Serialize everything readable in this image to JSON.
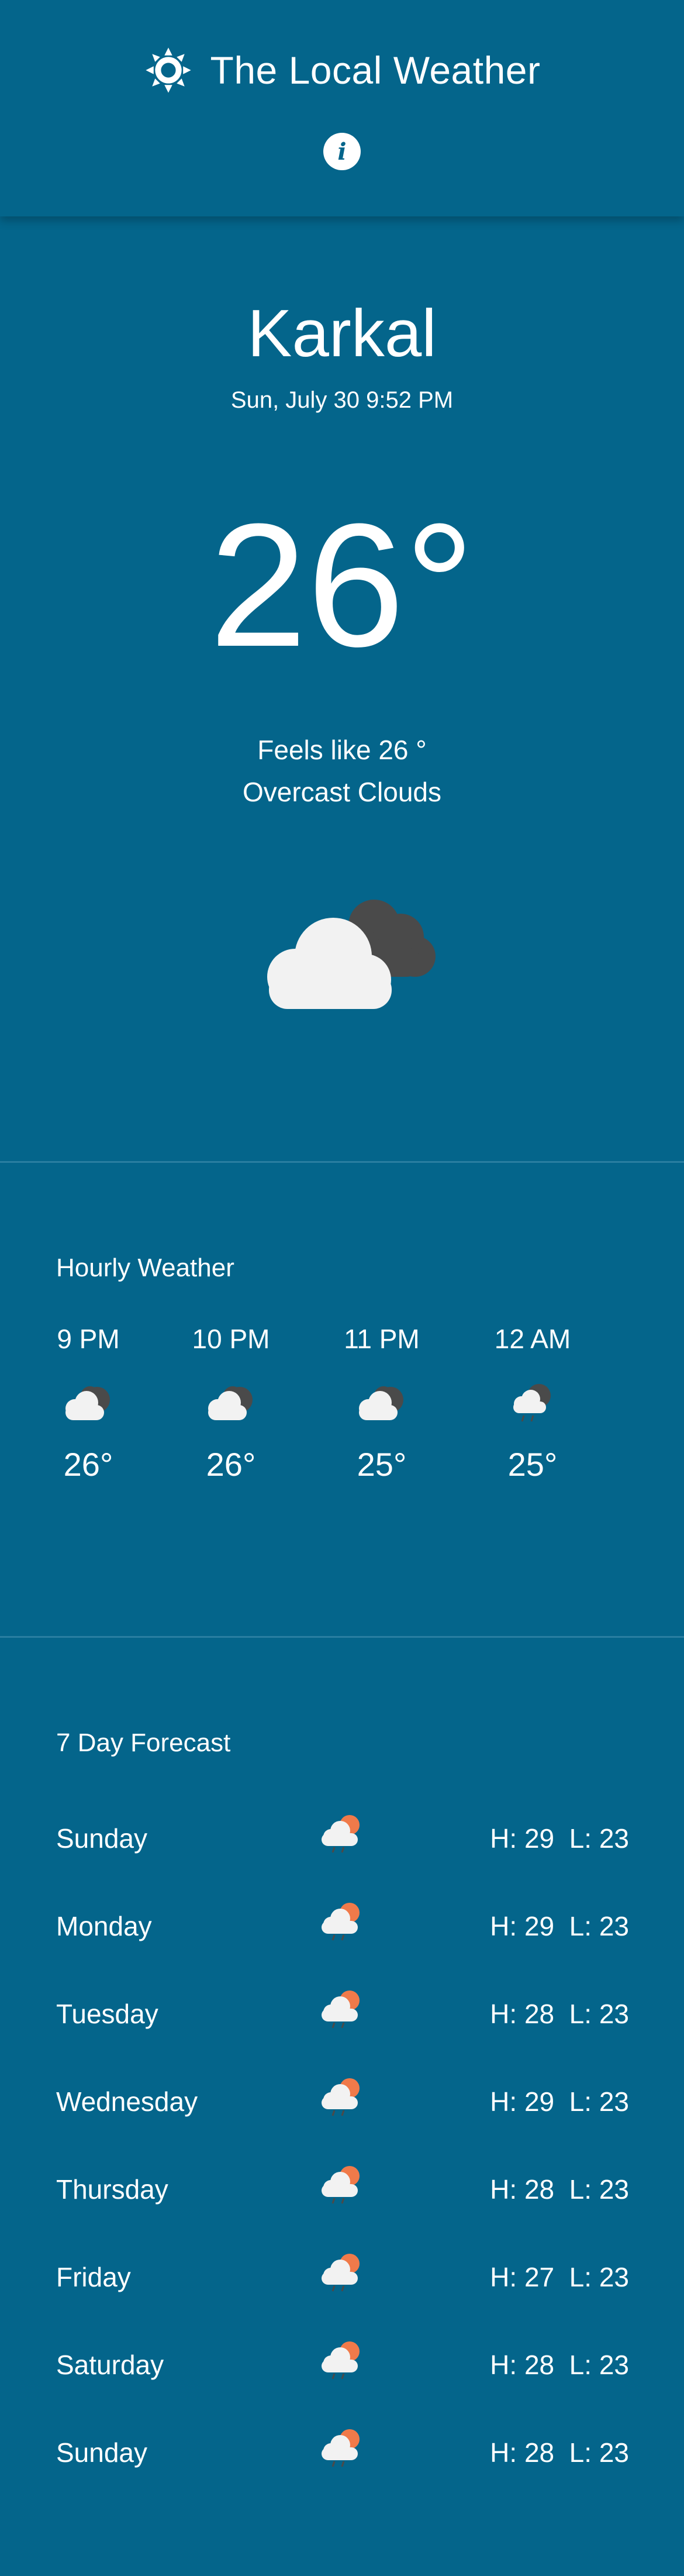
{
  "header": {
    "title": "The Local Weather",
    "logo_icon": "sun-icon",
    "info_icon": "info-icon",
    "info_glyph": "i"
  },
  "current": {
    "city": "Karkal",
    "datetime": "Sun, July 30 9:52 PM",
    "temperature": "26°",
    "feels_like": "Feels like 26 °",
    "description": "Overcast Clouds",
    "icon": "overcast-clouds-icon"
  },
  "hourly": {
    "title": "Hourly Weather",
    "items": [
      {
        "time": "9 PM",
        "temp": "26°",
        "icon": "cloud-moon-icon"
      },
      {
        "time": "10 PM",
        "temp": "26°",
        "icon": "cloud-moon-icon"
      },
      {
        "time": "11 PM",
        "temp": "25°",
        "icon": "cloud-moon-icon"
      },
      {
        "time": "12 AM",
        "temp": "25°",
        "icon": "cloud-rain-night-icon"
      }
    ]
  },
  "forecast": {
    "title": "7 Day Forecast",
    "days": [
      {
        "day": "Sunday",
        "hl": "H: 29  L: 23",
        "icon": "sun-cloud-rain-icon"
      },
      {
        "day": "Monday",
        "hl": "H: 29  L: 23",
        "icon": "sun-cloud-rain-icon"
      },
      {
        "day": "Tuesday",
        "hl": "H: 28  L: 23",
        "icon": "sun-cloud-rain-icon"
      },
      {
        "day": "Wednesday",
        "hl": "H: 29  L: 23",
        "icon": "sun-cloud-rain-icon"
      },
      {
        "day": "Thursday",
        "hl": "H: 28  L: 23",
        "icon": "sun-cloud-rain-icon"
      },
      {
        "day": "Friday",
        "hl": "H: 27  L: 23",
        "icon": "sun-cloud-rain-icon"
      },
      {
        "day": "Saturday",
        "hl": "H: 28  L: 23",
        "icon": "sun-cloud-rain-icon"
      },
      {
        "day": "Sunday",
        "hl": "H: 28  L: 23",
        "icon": "sun-cloud-rain-icon"
      }
    ]
  },
  "colors": {
    "background": "#04658b",
    "text": "#ffffff",
    "divider": "#2a7ea1",
    "cloud": "#f2f2f2",
    "dark_cloud": "#4a4a4a",
    "sun": "#f07a4a"
  }
}
